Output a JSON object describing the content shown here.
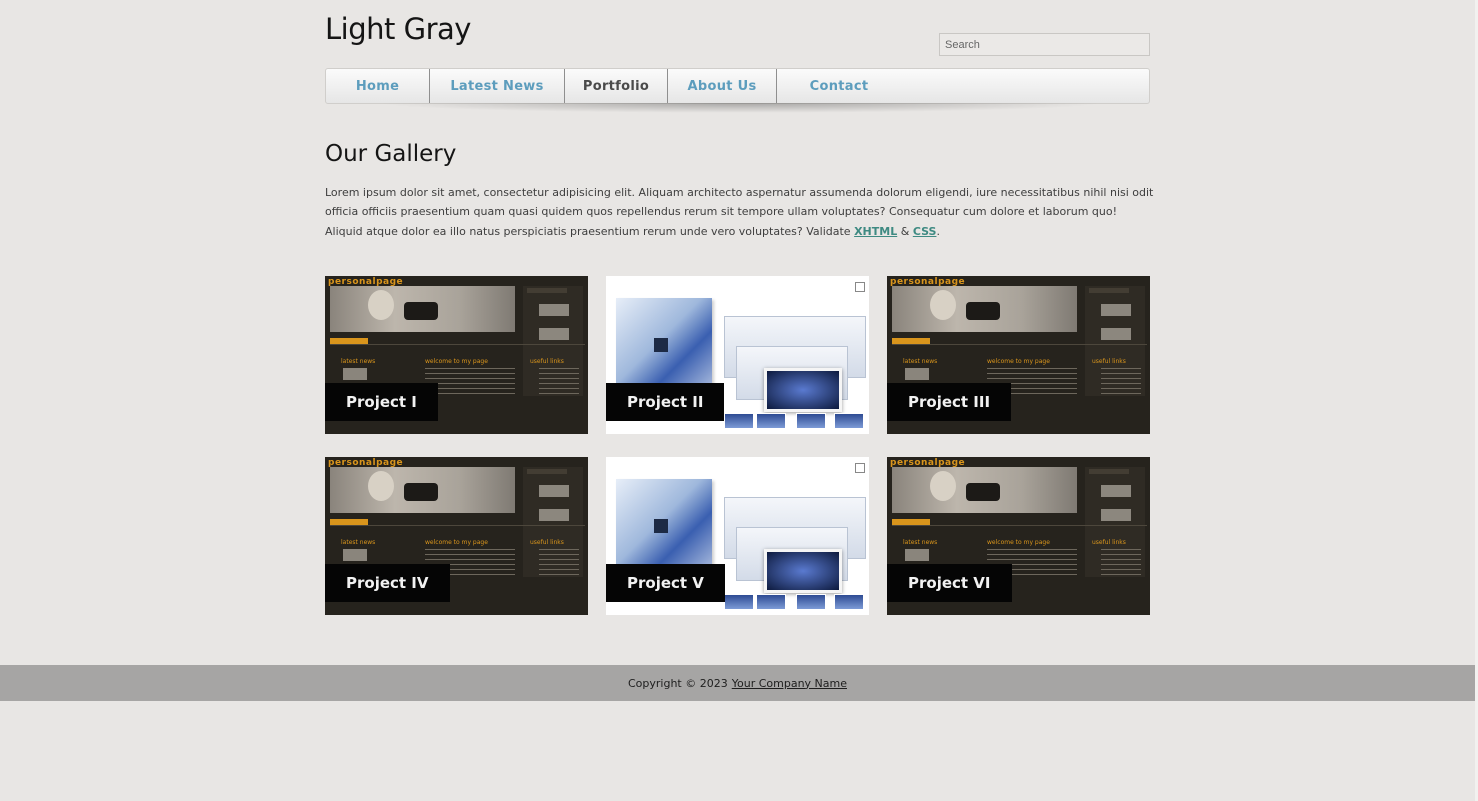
{
  "site": {
    "title": "Light Gray"
  },
  "search": {
    "placeholder": "Search"
  },
  "nav": {
    "items": [
      {
        "label": "Home",
        "active": false
      },
      {
        "label": "Latest News",
        "active": false
      },
      {
        "label": "Portfolio",
        "active": true
      },
      {
        "label": "About Us",
        "active": false
      },
      {
        "label": "Contact",
        "active": false
      }
    ]
  },
  "main": {
    "heading": "Our Gallery",
    "intro_text": "Lorem ipsum dolor sit amet, consectetur adipisicing elit. Aliquam architecto aspernatur assumenda dolorum eligendi, iure necessitatibus nihil nisi odit officia officiis praesentium quam quasi quidem quos repellendus rerum sit tempore ullam voluptates? Consequatur cum dolore et laborum quo! Aliquid atque dolor ea illo natus perspiciatis praesentium rerum unde vero voluptates? Validate",
    "link_xhtml": "XHTML",
    "amp": "&",
    "link_css": "CSS",
    "period": "."
  },
  "gallery": {
    "items": [
      {
        "label": "Project I",
        "thumbnail": "personal-page-screenshot"
      },
      {
        "label": "Project II",
        "thumbnail": "product-box-screenshot"
      },
      {
        "label": "Project III",
        "thumbnail": "personal-page-screenshot"
      },
      {
        "label": "Project IV",
        "thumbnail": "personal-page-screenshot"
      },
      {
        "label": "Project V",
        "thumbnail": "product-box-screenshot"
      },
      {
        "label": "Project VI",
        "thumbnail": "personal-page-screenshot"
      }
    ],
    "thumb_text": {
      "logo": "personalpage",
      "welcome": "welcome to my page",
      "news": "latest news",
      "useful": "useful links"
    }
  },
  "footer": {
    "copyright": "Copyright © 2023",
    "company_link": "Your Company Name"
  }
}
